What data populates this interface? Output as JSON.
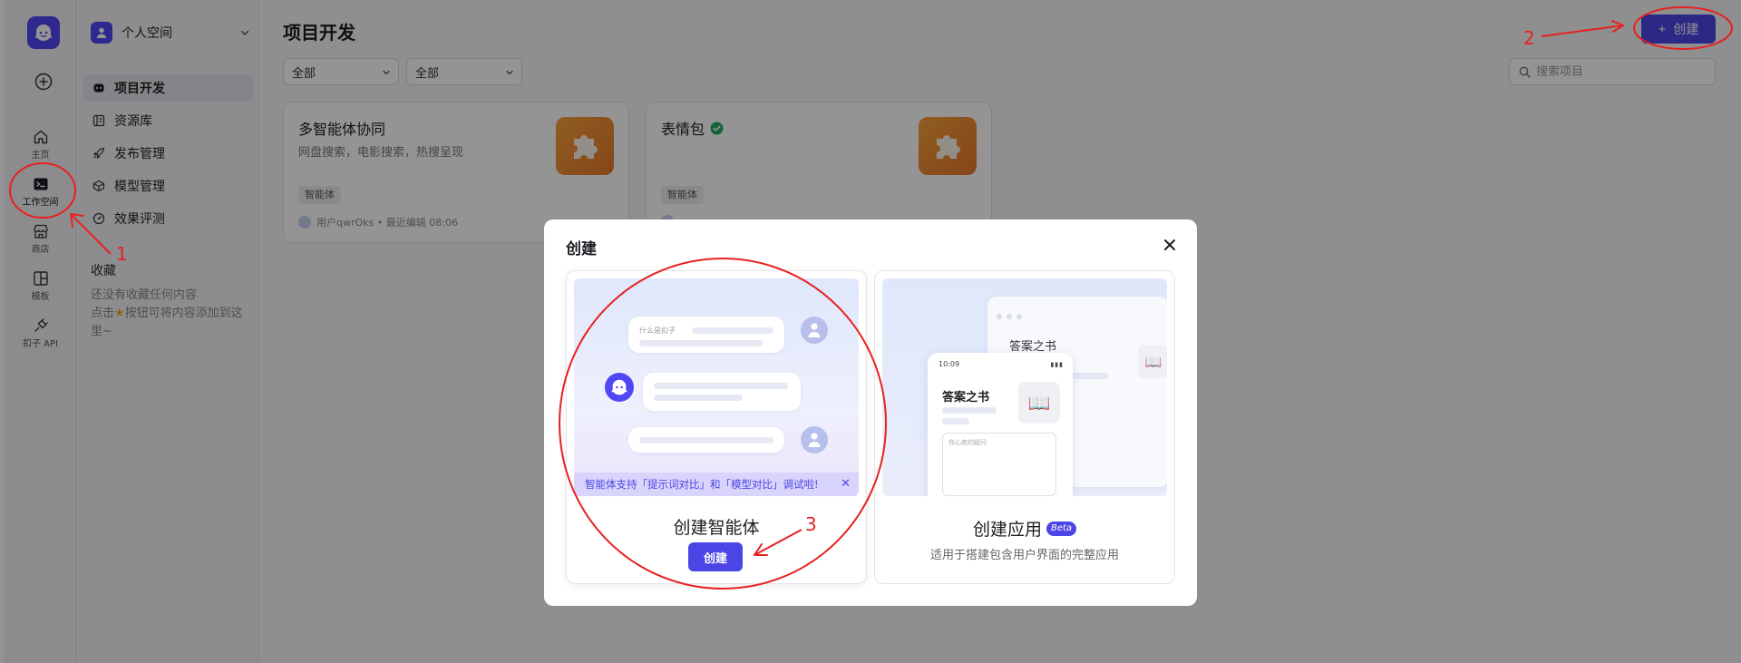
{
  "rail": {
    "items": [
      {
        "label": "主页"
      },
      {
        "label": "工作空间"
      },
      {
        "label": "商店"
      },
      {
        "label": "模板"
      },
      {
        "label": "扣子 API"
      }
    ]
  },
  "sidebar": {
    "space_name": "个人空间",
    "nav": [
      {
        "label": "项目开发"
      },
      {
        "label": "资源库"
      },
      {
        "label": "发布管理"
      },
      {
        "label": "模型管理"
      },
      {
        "label": "效果评测"
      }
    ],
    "favorites_title": "收藏",
    "favorites_empty_line1": "还没有收藏任何内容",
    "favorites_empty_line2": "点击",
    "favorites_empty_line3": "按钮可将内容添加到这里~"
  },
  "main": {
    "title": "项目开发",
    "create_label": "创建",
    "filter1": "全部",
    "filter2": "全部",
    "search_placeholder": "搜索项目",
    "cards": [
      {
        "title": "多智能体协同",
        "desc": "网盘搜索，电影搜索，热搜呈现",
        "tag": "智能体",
        "meta": "用户qwrOks • 最近编辑 08:06"
      },
      {
        "title": "表情包",
        "desc": "",
        "tag": "智能体",
        "meta": ""
      }
    ]
  },
  "modal": {
    "title": "创建",
    "agent": {
      "preview_question": "什么是扣子",
      "notice": "智能体支持「提示词对比」和「模型对比」调试啦!",
      "title": "创建智能体",
      "button": "创建"
    },
    "app": {
      "window_title": "答案之书",
      "phone_time": "10:09",
      "phone_title": "答案之书",
      "phone_placeholder": "你心底的疑问",
      "title": "创建应用",
      "badge": "Beta",
      "subtitle": "适用于搭建包含用户界面的完整应用"
    }
  },
  "annotations": [
    "1",
    "2",
    "3"
  ],
  "colors": {
    "brand": "#4c45e6",
    "annotation": "#e82020",
    "card_icon": "#f09535"
  }
}
